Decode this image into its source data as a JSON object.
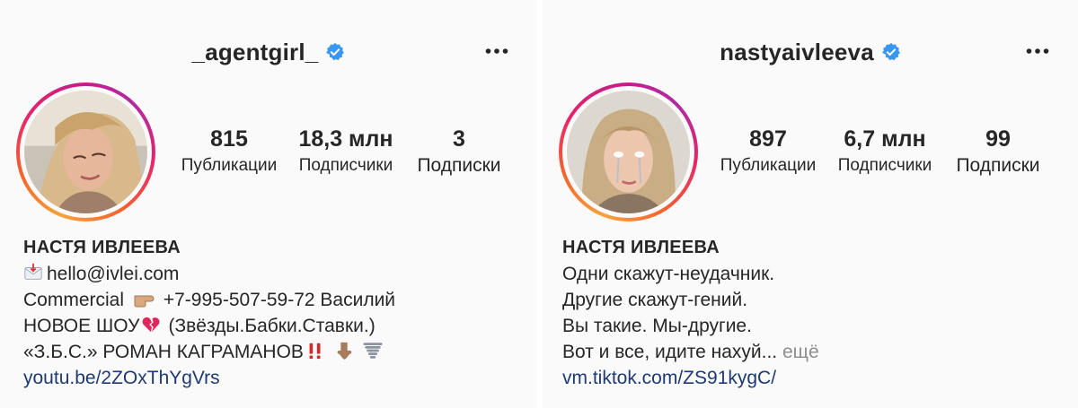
{
  "left": {
    "username": "_agentgirl_",
    "stats": [
      {
        "value": "815",
        "label": "Публикации"
      },
      {
        "value": "18,3 млн",
        "label": "Подписчики"
      },
      {
        "value": "3",
        "label": "Подписки"
      }
    ],
    "name": "НАСТЯ ИВЛЕЕВА",
    "bio": {
      "email": "hello@ivlei.com",
      "commercial_a": "Commercial",
      "commercial_b": "+7-995-507-59-72 Василий",
      "show_a": "НОВОЕ ШОУ",
      "show_b": "(Звёзды.Бабки.Ставки.)",
      "show2": "«З.Б.С.» РОМАН КАГРАМАНОВ",
      "link": "youtu.be/2ZOxThYgVrs"
    },
    "icons": [
      "envelope-icon",
      "pointing-right-icon",
      "broken-heart-icon",
      "double-exclamation-icon",
      "pointing-down-icon",
      "tornado-icon"
    ]
  },
  "right": {
    "username": "nastyaivleeva",
    "stats": [
      {
        "value": "897",
        "label": "Публикации"
      },
      {
        "value": "6,7 млн",
        "label": "Подписчики"
      },
      {
        "value": "99",
        "label": "Подписки"
      }
    ],
    "name": "НАСТЯ ИВЛЕЕВА",
    "bio": {
      "l1": "Одни скажут-неудачник.",
      "l2": "Другие скажут-гений.",
      "l3": "Вы такие. Мы-другие.",
      "l4": "Вот и все, идите нахуй...",
      "more": "ещё",
      "link": "vm.tiktok.com/ZS91kygC/"
    }
  },
  "colors": {
    "verified": "#3897f0",
    "link": "#1e3a72",
    "muted": "#8e8e8e",
    "text": "#262626"
  }
}
